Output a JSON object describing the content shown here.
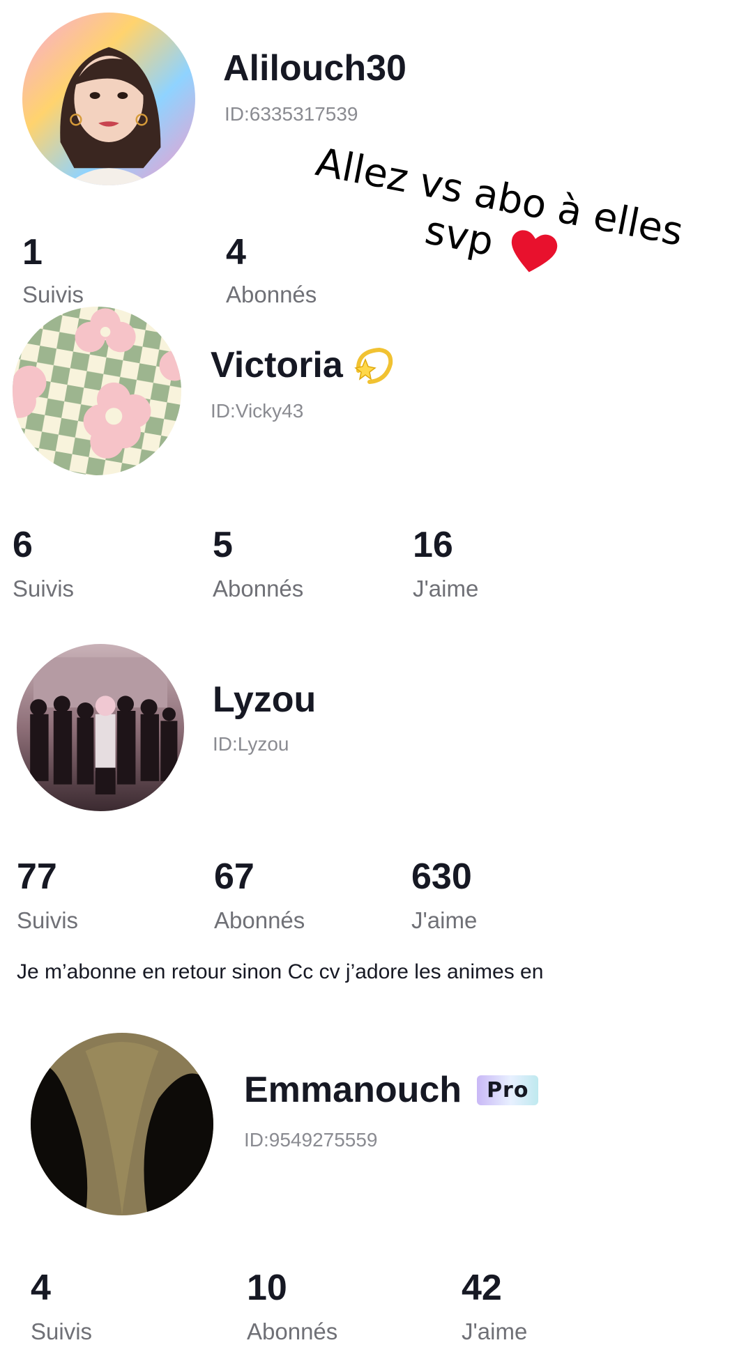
{
  "overlay": {
    "line1": "Allez vs abo à elles",
    "line2": "svp"
  },
  "profiles": [
    {
      "name": "Alilouch30",
      "id_text": "ID:6335317539",
      "stats": [
        {
          "value": "1",
          "label": "Suivis"
        },
        {
          "value": "4",
          "label": "Abonnés"
        }
      ]
    },
    {
      "name": "Victoria",
      "id_text": "ID:Vicky43",
      "stats": [
        {
          "value": "6",
          "label": "Suivis"
        },
        {
          "value": "5",
          "label": "Abonnés"
        },
        {
          "value": "16",
          "label": "J'aime"
        }
      ]
    },
    {
      "name": "Lyzou",
      "id_text": "ID:Lyzou",
      "stats": [
        {
          "value": "77",
          "label": "Suivis"
        },
        {
          "value": "67",
          "label": "Abonnés"
        },
        {
          "value": "630",
          "label": "J'aime"
        }
      ],
      "bio": "Je m’abonne en retour sinon Cc cv j’adore les animes  en"
    },
    {
      "name": "Emmanouch",
      "badge": "Pro",
      "id_text": "ID:9549275559",
      "stats": [
        {
          "value": "4",
          "label": "Suivis"
        },
        {
          "value": "10",
          "label": "Abonnés"
        },
        {
          "value": "42",
          "label": "J'aime"
        }
      ]
    }
  ],
  "colors": {
    "text_primary": "#161823",
    "text_secondary": "#8a8b91",
    "heart": "#e8112d"
  }
}
